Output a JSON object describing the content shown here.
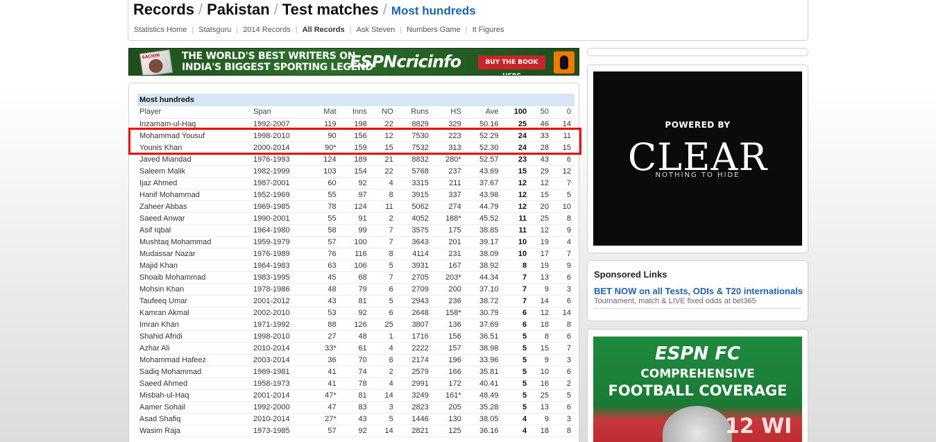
{
  "breadcrumb": {
    "items": [
      "Records",
      "Pakistan",
      "Test matches"
    ],
    "current": "Most hundreds"
  },
  "nav": [
    "Statistics Home",
    "Statsguru",
    "2014 Records",
    "All Records",
    "Ask Steven",
    "Numbers Game",
    "It Figures"
  ],
  "nav_active": "All Records",
  "banner": {
    "line1": "THE WORLD'S BEST WRITERS ON",
    "line2": "INDIA'S BIGGEST SPORTING LEGEND",
    "logo": "ESPNcricinfo",
    "button": "BUY THE BOOK HERE",
    "book_text": "SACHIN"
  },
  "table": {
    "caption": "Most hundreds",
    "headers": [
      "Player",
      "Span",
      "Mat",
      "Inns",
      "NO",
      "Runs",
      "HS",
      "Ave",
      "100",
      "50",
      "0"
    ],
    "rows": [
      [
        "Inzamam-ul-Haq",
        "1992-2007",
        "119",
        "198",
        "22",
        "8829",
        "329",
        "50.16",
        "25",
        "46",
        "14"
      ],
      [
        "Mohammad Yousuf",
        "1998-2010",
        "90",
        "156",
        "12",
        "7530",
        "223",
        "52.29",
        "24",
        "33",
        "11"
      ],
      [
        "Younis Khan",
        "2000-2014",
        "90*",
        "159",
        "15",
        "7532",
        "313",
        "52.30",
        "24",
        "28",
        "15"
      ],
      [
        "Javed Miandad",
        "1976-1993",
        "124",
        "189",
        "21",
        "8832",
        "280*",
        "52.57",
        "23",
        "43",
        "6"
      ],
      [
        "Saleem Malik",
        "1982-1999",
        "103",
        "154",
        "22",
        "5768",
        "237",
        "43.69",
        "15",
        "29",
        "12"
      ],
      [
        "Ijaz Ahmed",
        "1987-2001",
        "60",
        "92",
        "4",
        "3315",
        "211",
        "37.67",
        "12",
        "12",
        "7"
      ],
      [
        "Hanif Mohammad",
        "1952-1969",
        "55",
        "97",
        "8",
        "3915",
        "337",
        "43.98",
        "12",
        "15",
        "5"
      ],
      [
        "Zaheer Abbas",
        "1969-1985",
        "78",
        "124",
        "11",
        "5062",
        "274",
        "44.79",
        "12",
        "20",
        "10"
      ],
      [
        "Saeed Anwar",
        "1990-2001",
        "55",
        "91",
        "2",
        "4052",
        "188*",
        "45.52",
        "11",
        "25",
        "8"
      ],
      [
        "Asif Iqbal",
        "1964-1980",
        "58",
        "99",
        "7",
        "3575",
        "175",
        "38.85",
        "11",
        "12",
        "9"
      ],
      [
        "Mushtaq Mohammad",
        "1959-1979",
        "57",
        "100",
        "7",
        "3643",
        "201",
        "39.17",
        "10",
        "19",
        "4"
      ],
      [
        "Mudassar Nazar",
        "1976-1989",
        "76",
        "116",
        "8",
        "4114",
        "231",
        "38.09",
        "10",
        "17",
        "7"
      ],
      [
        "Majid Khan",
        "1964-1983",
        "63",
        "106",
        "5",
        "3931",
        "167",
        "38.92",
        "8",
        "19",
        "9"
      ],
      [
        "Shoaib Mohammad",
        "1983-1995",
        "45",
        "68",
        "7",
        "2705",
        "203*",
        "44.34",
        "7",
        "13",
        "6"
      ],
      [
        "Mohsin Khan",
        "1978-1986",
        "48",
        "79",
        "6",
        "2709",
        "200",
        "37.10",
        "7",
        "9",
        "3"
      ],
      [
        "Taufeeq Umar",
        "2001-2012",
        "43",
        "81",
        "5",
        "2943",
        "236",
        "38.72",
        "7",
        "14",
        "6"
      ],
      [
        "Kamran Akmal",
        "2002-2010",
        "53",
        "92",
        "6",
        "2648",
        "158*",
        "30.79",
        "6",
        "12",
        "14"
      ],
      [
        "Imran Khan",
        "1971-1992",
        "88",
        "126",
        "25",
        "3807",
        "136",
        "37.69",
        "6",
        "18",
        "8"
      ],
      [
        "Shahid Afridi",
        "1998-2010",
        "27",
        "48",
        "1",
        "1716",
        "156",
        "36.51",
        "5",
        "8",
        "6"
      ],
      [
        "Azhar Ali",
        "2010-2014",
        "33*",
        "61",
        "4",
        "2222",
        "157",
        "38.98",
        "5",
        "15",
        "7"
      ],
      [
        "Mohammad Hafeez",
        "2003-2014",
        "36",
        "70",
        "6",
        "2174",
        "196",
        "33.96",
        "5",
        "9",
        "3"
      ],
      [
        "Sadiq Mohammad",
        "1969-1981",
        "41",
        "74",
        "2",
        "2579",
        "166",
        "35.81",
        "5",
        "10",
        "6"
      ],
      [
        "Saeed Ahmed",
        "1958-1973",
        "41",
        "78",
        "4",
        "2991",
        "172",
        "40.41",
        "5",
        "16",
        "2"
      ],
      [
        "Misbah-ul-Haq",
        "2001-2014",
        "47*",
        "81",
        "14",
        "3249",
        "161*",
        "48.49",
        "5",
        "25",
        "5"
      ],
      [
        "Aamer Sohail",
        "1992-2000",
        "47",
        "83",
        "3",
        "2823",
        "205",
        "35.28",
        "5",
        "13",
        "6"
      ],
      [
        "Asad Shafiq",
        "2010-2014",
        "27*",
        "43",
        "5",
        "1446",
        "130",
        "38.05",
        "4",
        "9",
        "3"
      ],
      [
        "Wasim Raja",
        "1973-1985",
        "57",
        "92",
        "14",
        "2821",
        "125",
        "36.16",
        "4",
        "18",
        "8"
      ]
    ]
  },
  "ad1": {
    "powered": "POWERED BY",
    "brand": "CLEAR",
    "tagline": "NOTHING TO HIDE"
  },
  "sponsored": {
    "title": "Sponsored Links",
    "link": "BET NOW on all Tests, ODIs & T20 internationals",
    "desc": "Tournament, match & LIVE fixed odds at bet365"
  },
  "ad2": {
    "brand": "ESPN FC",
    "line1": "COMPREHENSIVE",
    "line2": "FOOTBALL COVERAGE",
    "badge": "12 WI"
  },
  "colors": {
    "link_blue": "#1d63ad",
    "highlight_red": "#e00000",
    "caption_bg": "#d7e6f4"
  }
}
